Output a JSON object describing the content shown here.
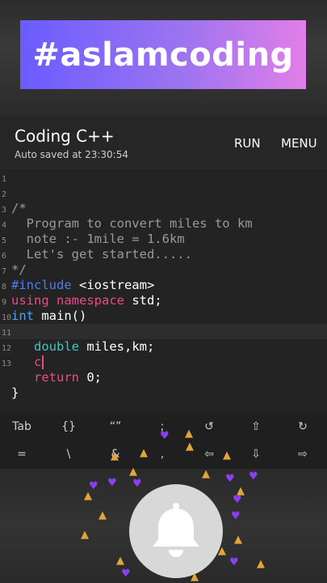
{
  "banner": {
    "text": "#aslamcoding"
  },
  "appbar": {
    "title": "Coding C++",
    "autosave": "Auto saved at 23:30:54",
    "run_label": "RUN",
    "menu_label": "MENU"
  },
  "editor": {
    "line_numbers": [
      "1",
      "2",
      "3",
      "4",
      "5",
      "6",
      "7",
      "8",
      "9",
      "10",
      "11",
      "12",
      "13"
    ],
    "lines": {
      "l1": "/*",
      "l2": "  Program to convert miles to km",
      "l3": "  note :- 1mile = 1.6km",
      "l4": "  Let's get started.....",
      "l5": "*/",
      "l6a": "#include",
      "l6b": " <iostream>",
      "l7a": "using namespace",
      "l7b": " std;",
      "l8a": "int",
      "l8b": " main()",
      "l9": "{",
      "l10a": "   double",
      "l10b": " miles,km;",
      "l11": "   c",
      "l12a": "   return",
      "l12b": " 0;",
      "l13": "}"
    }
  },
  "keyboard": {
    "row1": [
      "Tab",
      "{}",
      "“”",
      ";",
      "↺",
      "⇧",
      "↻"
    ],
    "row2": [
      "=",
      "\\",
      "&",
      ",",
      "⇦",
      "⇩",
      "⇨"
    ]
  },
  "icons": {
    "bell": "bell-icon",
    "heart_reaction": "purple-heart-icon",
    "bell_reaction": "bell-reaction-icon"
  },
  "colors": {
    "banner_start": "#6a5cff",
    "banner_end": "#e27ee8",
    "keyword": "#e94b8a",
    "type": "#4aa3ff",
    "comment": "#9a9a9a"
  }
}
